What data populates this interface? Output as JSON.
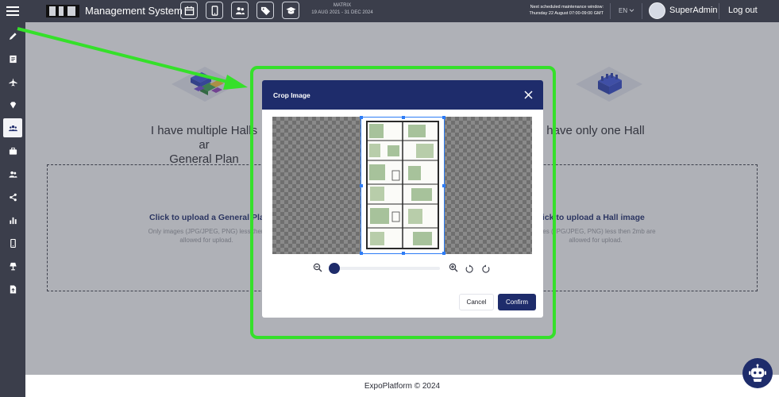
{
  "header": {
    "app_title": "Management System",
    "event": {
      "name": "MATRIX",
      "dates": "19 AUG 2021 - 31 DEC 2024"
    },
    "maintenance": {
      "label": "Next scheduled maintenance window:",
      "value": "Thursday 22 August 07:00-09:00 GMT"
    },
    "language": "EN",
    "user_name": "SuperAdmin",
    "logout_label": "Log out",
    "tools": [
      "calendar-icon",
      "mobile-icon",
      "people-icon",
      "tag-icon",
      "graduation-cap-icon"
    ]
  },
  "sidebar": {
    "items": [
      {
        "icon": "pencil-icon"
      },
      {
        "icon": "document-icon"
      },
      {
        "icon": "plane-icon"
      },
      {
        "icon": "diamond-icon"
      },
      {
        "icon": "people-group-icon",
        "active": true
      },
      {
        "icon": "briefcase-icon"
      },
      {
        "icon": "users-icon"
      },
      {
        "icon": "share-icon"
      },
      {
        "icon": "bar-chart-icon"
      },
      {
        "icon": "mobile-icon"
      },
      {
        "icon": "lamp-icon"
      },
      {
        "icon": "file-export-icon"
      }
    ]
  },
  "main": {
    "option_multiple": {
      "heading_line1": "I have multiple Halls ar",
      "heading_line2": "General Plan",
      "upload_title": "Click to upload a General Plan",
      "upload_hint_line1": "Only images (JPG/JPEG, PNG) less then",
      "upload_hint_line2": "allowed for upload."
    },
    "option_single": {
      "heading": "have only one Hall",
      "upload_title": "lick to upload a Hall image",
      "upload_hint_line1": "ages (JPG/JPEG, PNG) less then 2mb are",
      "upload_hint_line2": "allowed for upload."
    }
  },
  "modal": {
    "title": "Crop Image",
    "cancel_label": "Cancel",
    "confirm_label": "Confirm",
    "zoom_level": 0
  },
  "footer": {
    "text": "ExpoPlatform © 2024"
  },
  "colors": {
    "navy": "#1e2c6b",
    "topbar": "#3b3e4b",
    "highlight": "#35e02a",
    "crop_handle": "#2d7cf6"
  }
}
